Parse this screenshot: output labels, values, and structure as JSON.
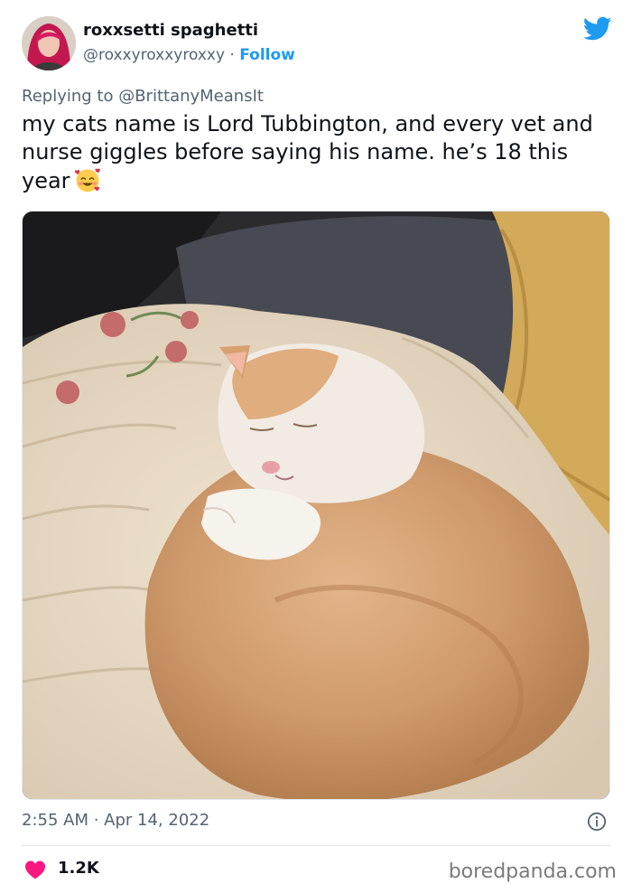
{
  "author": {
    "display_name": "roxxsetti spaghetti",
    "handle": "@roxxyroxxyroxxy",
    "separator": " · ",
    "follow_label": "Follow"
  },
  "reply": {
    "text": "Replying to @BrittanyMeansIt"
  },
  "tweet": {
    "text": "my cats name is Lord Tubbington, and every vet and nurse giggles before saying his name. he’s 18 this year",
    "emoji": "smiling-face-with-hearts"
  },
  "meta": {
    "timestamp": "2:55 AM · Apr 14, 2022",
    "likes": "1.2K"
  },
  "watermark": "boredpanda.com",
  "icons": {
    "brand": "twitter-bird-icon",
    "info": "info-icon",
    "like": "heart-icon"
  },
  "colors": {
    "accent": "#1d9bf0",
    "like": "#f91880",
    "secondary_text": "#536471"
  }
}
